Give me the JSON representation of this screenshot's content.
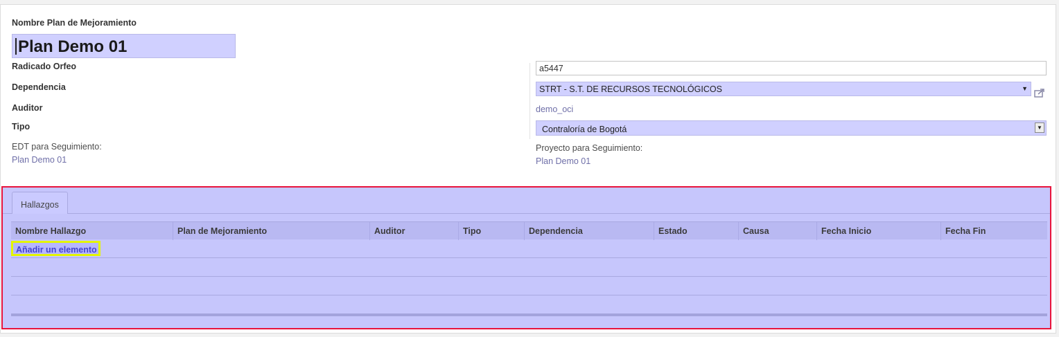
{
  "form": {
    "name_label": "Nombre Plan de Mejoramiento",
    "name_value": "Plan Demo 01",
    "radicado_label": "Radicado Orfeo",
    "radicado_value": "a5447",
    "dependencia_label": "Dependencia",
    "dependencia_value": "STRT - S.T. DE RECURSOS TECNOLÓGICOS",
    "auditor_label": "Auditor",
    "auditor_value": "demo_oci",
    "tipo_label": "Tipo",
    "tipo_value": "Contraloría de Bogotá",
    "edt_label": "EDT para Seguimiento:",
    "edt_value": "Plan Demo 01",
    "proyecto_label": "Proyecto para Seguimiento:",
    "proyecto_value": "Plan Demo 01"
  },
  "notebook": {
    "tab_label": "Hallazgos",
    "columns": [
      "Nombre Hallazgo",
      "Plan de Mejoramiento",
      "Auditor",
      "Tipo",
      "Dependencia",
      "Estado",
      "Causa",
      "Fecha Inicio",
      "Fecha Fin"
    ],
    "add_label": "Añadir un elemento"
  },
  "colors": {
    "highlight_border": "#e8143c",
    "add_button_border": "#e3f500",
    "field_bg": "#d0d0ff"
  }
}
